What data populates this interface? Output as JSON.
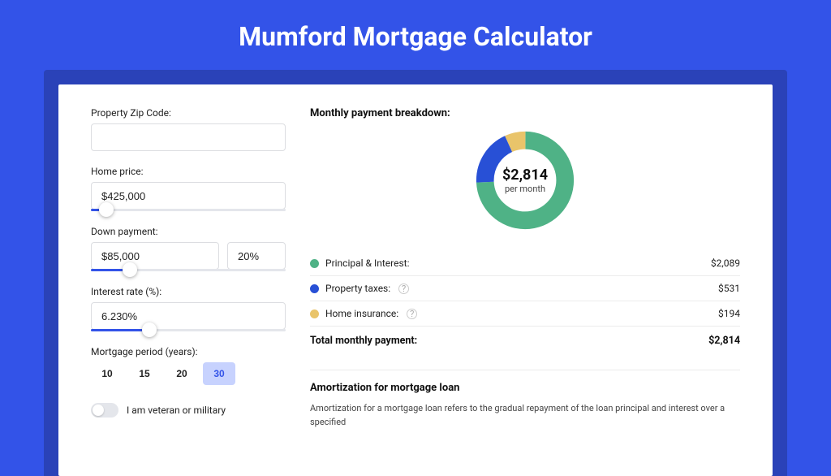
{
  "title": "Mumford Mortgage Calculator",
  "form": {
    "zip_label": "Property Zip Code:",
    "zip_value": "",
    "home_price_label": "Home price:",
    "home_price_value": "$425,000",
    "home_price_slider_pct": 8,
    "down_payment_label": "Down payment:",
    "down_payment_value": "$85,000",
    "down_payment_pct_value": "20%",
    "down_payment_slider_pct": 20,
    "interest_label": "Interest rate (%):",
    "interest_value": "6.230%",
    "interest_slider_pct": 30,
    "period_label": "Mortgage period (years):",
    "periods": [
      "10",
      "15",
      "20",
      "30"
    ],
    "period_selected": "30",
    "veteran_label": "I am veteran or military"
  },
  "breakdown": {
    "title": "Monthly payment breakdown:",
    "donut_amount": "$2,814",
    "donut_sub": "per month",
    "items": [
      {
        "label": "Principal & Interest:",
        "value": "$2,089",
        "info": false
      },
      {
        "label": "Property taxes:",
        "value": "$531",
        "info": true
      },
      {
        "label": "Home insurance:",
        "value": "$194",
        "info": true
      }
    ],
    "total_label": "Total monthly payment:",
    "total_value": "$2,814"
  },
  "chart_data": {
    "type": "pie",
    "title": "Monthly payment breakdown",
    "series": [
      {
        "name": "Principal & Interest",
        "value": 2089,
        "color": "#4fb286"
      },
      {
        "name": "Property taxes",
        "value": 531,
        "color": "#2850d6"
      },
      {
        "name": "Home insurance",
        "value": 194,
        "color": "#e9c46a"
      }
    ],
    "total": 2814,
    "center_label": "$2,814 per month"
  },
  "amortization": {
    "title": "Amortization for mortgage loan",
    "text": "Amortization for a mortgage loan refers to the gradual repayment of the loan principal and interest over a specified"
  }
}
